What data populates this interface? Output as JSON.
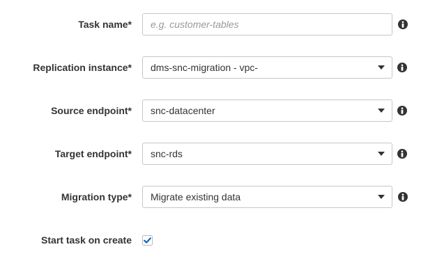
{
  "form": {
    "task_name": {
      "label": "Task name*",
      "value": "",
      "placeholder": "e.g. customer-tables"
    },
    "replication_instance": {
      "label": "Replication instance*",
      "value": "dms-snc-migration - vpc-"
    },
    "source_endpoint": {
      "label": "Source endpoint*",
      "value": "snc-datacenter"
    },
    "target_endpoint": {
      "label": "Target endpoint*",
      "value": "snc-rds"
    },
    "migration_type": {
      "label": "Migration type*",
      "value": "Migrate existing data"
    },
    "start_task": {
      "label": "Start task on create",
      "checked": true
    }
  },
  "icons": {
    "info": "info-circle-icon",
    "caret": "caret-down-icon",
    "check": "checkmark-icon"
  },
  "colors": {
    "info_icon": "#333333",
    "check_accent": "#1166bb"
  }
}
